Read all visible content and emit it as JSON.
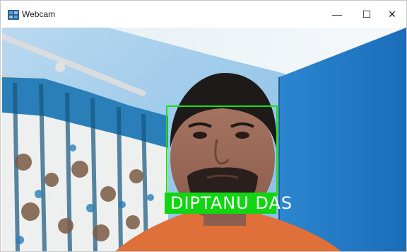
{
  "window": {
    "title": "Webcam",
    "controls": {
      "minimize": "—",
      "maximize": "☐",
      "close": "✕"
    }
  },
  "detection": {
    "label": "DIPTANU  DAS",
    "box_color": "#18e018"
  },
  "icons": {
    "app": "webcam-app-icon",
    "minimize": "minimize-icon",
    "maximize": "maximize-icon",
    "close": "close-icon"
  }
}
